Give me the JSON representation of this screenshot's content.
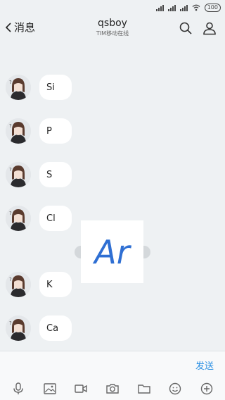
{
  "status_bar": {
    "battery": "100",
    "signal_icons": [
      "signal-icon",
      "signal-icon",
      "signal-icon"
    ],
    "wifi_icon": "wifi-icon"
  },
  "header": {
    "back_label": "消息",
    "title": "qsboy",
    "subtitle": "TIM移动在线",
    "search_icon": "search-icon",
    "profile_icon": "profile-icon"
  },
  "messages": [
    {
      "text": "Si"
    },
    {
      "text": "P"
    },
    {
      "text": "S"
    },
    {
      "text": "Cl"
    },
    {
      "text": "K"
    },
    {
      "text": "Ca"
    }
  ],
  "overlay": {
    "text": "Ar"
  },
  "input": {
    "value": "",
    "placeholder": "",
    "send_label": "发送"
  },
  "toolbar": {
    "items": [
      "microphone-icon",
      "image-icon",
      "video-icon",
      "camera-icon",
      "folder-icon",
      "emoji-icon",
      "plus-icon"
    ]
  },
  "colors": {
    "background": "#eef1f3",
    "accent": "#2a8fe3",
    "overlay_text": "#2f6fd3",
    "bubble": "#ffffff"
  }
}
